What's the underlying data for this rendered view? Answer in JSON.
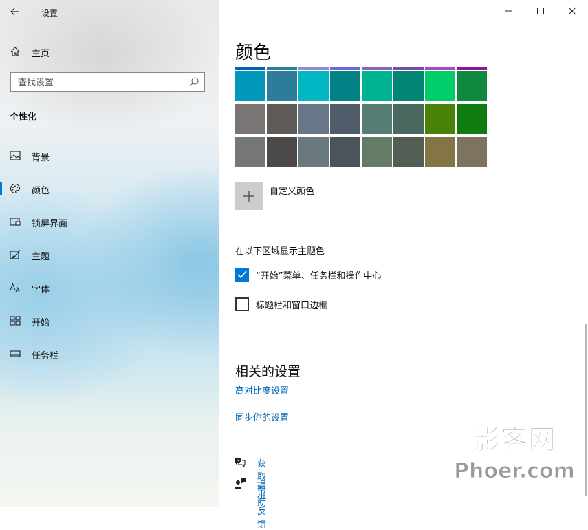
{
  "window": {
    "title": "设置"
  },
  "sidebar": {
    "home_label": "主页",
    "search_placeholder": "查找设置",
    "section_label": "个性化",
    "items": [
      {
        "label": "背景",
        "icon": "picture-icon"
      },
      {
        "label": "颜色",
        "icon": "palette-icon",
        "active": true
      },
      {
        "label": "锁屏界面",
        "icon": "lock-screen-icon"
      },
      {
        "label": "主题",
        "icon": "theme-brush-icon"
      },
      {
        "label": "字体",
        "icon": "font-icon"
      },
      {
        "label": "开始",
        "icon": "start-tiles-icon"
      },
      {
        "label": "任务栏",
        "icon": "taskbar-icon"
      }
    ]
  },
  "main": {
    "title": "颜色",
    "swatch_top_strip": [
      "#0063b1",
      "#2d7d9a",
      "#8e8cd8",
      "#6b69d6",
      "#8764b8",
      "#744da9",
      "#b146c2",
      "#881798"
    ],
    "swatch_rows": [
      [
        "#0099bc",
        "#2d7d9a",
        "#00b7c3",
        "#038387",
        "#00b294",
        "#018574",
        "#00cc6a",
        "#10893e"
      ],
      [
        "#7a7574",
        "#5d5a58",
        "#68768a",
        "#515c6b",
        "#567c73",
        "#486860",
        "#498205",
        "#107c10"
      ],
      [
        "#767676",
        "#4c4a48",
        "#69797e",
        "#4a5459",
        "#647c64",
        "#525e54",
        "#847545",
        "#7e735f"
      ]
    ],
    "custom_color_label": "自定义颜色",
    "show_accent_label": "在以下区域显示主题色",
    "checkbox_start": {
      "label": "“开始”菜单、任务栏和操作中心",
      "checked": true
    },
    "checkbox_titlebar": {
      "label": "标题栏和窗口边框",
      "checked": false
    },
    "related_title": "相关的设置",
    "link_high_contrast": "高对比度设置",
    "link_sync": "同步你的设置",
    "get_help": "获取帮助",
    "feedback": "提供反馈",
    "accent_color": "#0078d7",
    "link_color": "#0067b8"
  },
  "watermark": {
    "line1": "影客网",
    "line2": "Phoer.com"
  }
}
